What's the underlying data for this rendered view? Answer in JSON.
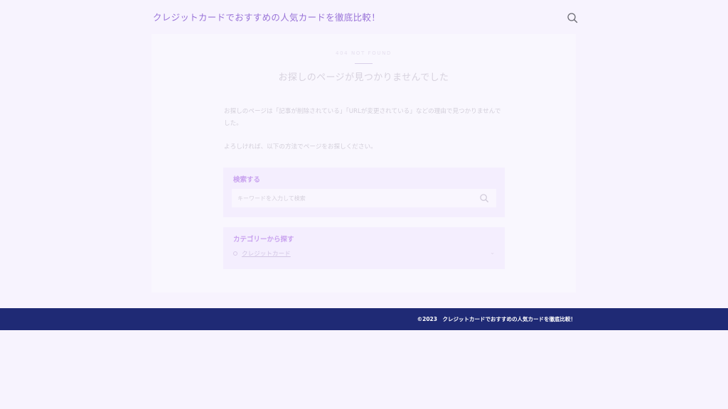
{
  "header": {
    "site_title": "クレジットカードでおすすめの人気カードを徹底比較！",
    "search_icon": "search-icon"
  },
  "main": {
    "eyebrow": "404 NOT FOUND",
    "title": "お探しのページが見つかりませんでした",
    "paragraph1": "お探しのページは「記事が削除されている」「URLが変更されている」などの理由で見つかりませんでした。",
    "paragraph2": "よろしければ、以下の方法でページをお探しください。"
  },
  "search_widget": {
    "title": "検索する",
    "placeholder": "キーワードを入力して検索",
    "icon": "search-icon"
  },
  "category_widget": {
    "title": "カテゴリーから探す",
    "items": [
      {
        "label": "クレジットカード",
        "icon": "chevron-down-icon"
      }
    ]
  },
  "footer": {
    "copyright": "©2023　クレジットカードでおすすめの人気カードを徹底比較！"
  },
  "colors": {
    "accent": "#9a74d8",
    "footer_bg": "#1f2a75",
    "page_bg": "#f7f3fe"
  }
}
